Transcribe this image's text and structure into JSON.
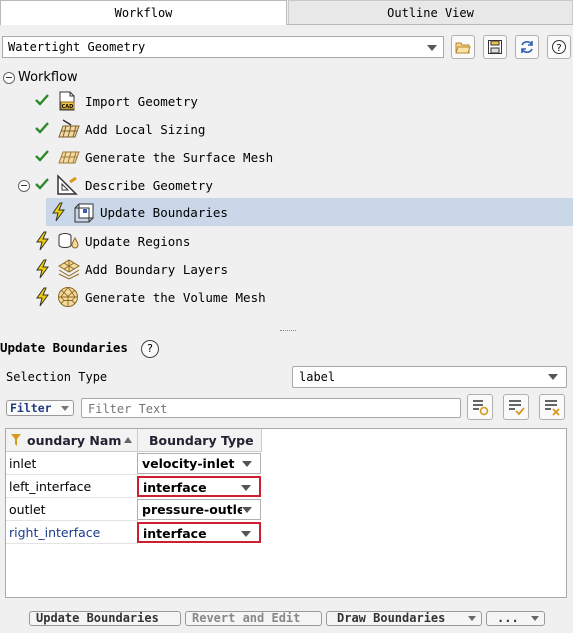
{
  "tabs": {
    "workflow": "Workflow",
    "outline": "Outline View"
  },
  "workflow_selector": {
    "value": "Watertight Geometry"
  },
  "tree": {
    "root": "Workflow",
    "items": [
      {
        "label": "Import Geometry",
        "status": "done",
        "icon": "cad-import-icon"
      },
      {
        "label": "Add Local Sizing",
        "status": "done",
        "icon": "local-sizing-icon"
      },
      {
        "label": "Generate the Surface Mesh",
        "status": "done",
        "icon": "surface-mesh-icon"
      },
      {
        "label": "Describe Geometry",
        "status": "done",
        "icon": "describe-geometry-icon"
      },
      {
        "label": "Update Boundaries",
        "status": "pending",
        "icon": "update-boundaries-icon"
      },
      {
        "label": "Update Regions",
        "status": "pending",
        "icon": "update-regions-icon"
      },
      {
        "label": "Add Boundary Layers",
        "status": "pending",
        "icon": "boundary-layers-icon"
      },
      {
        "label": "Generate the Volume Mesh",
        "status": "pending",
        "icon": "volume-mesh-icon"
      }
    ]
  },
  "panel": {
    "title": "Update Boundaries",
    "help": "?",
    "selection_type_label": "Selection Type",
    "selection_type_value": "label",
    "filter_label": "Filter",
    "filter_placeholder": "Filter Text"
  },
  "table": {
    "headers": {
      "name": "oundary Nam",
      "type": "Boundary Type"
    },
    "rows": [
      {
        "name": "inlet",
        "type": "velocity-inlet",
        "highlighted": false
      },
      {
        "name": "left_interface",
        "type": "interface",
        "highlighted": true
      },
      {
        "name": "outlet",
        "type": "pressure-outle",
        "highlighted": false
      },
      {
        "name": "right_interface",
        "type": "interface",
        "highlighted": true
      }
    ]
  },
  "buttons": {
    "update": "Update Boundaries",
    "revert": "Revert and Edit",
    "draw": "Draw Boundaries",
    "more": "..."
  },
  "colors": {
    "selection_bg": "#c9d7e8",
    "highlight_border": "#cc1f2f",
    "check_green": "#2c8a2c",
    "bolt_yellow": "#f3d000"
  }
}
